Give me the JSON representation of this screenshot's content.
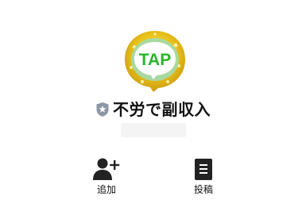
{
  "profile": {
    "logo_text": "TAP",
    "account_name": "不労で副収入",
    "badge_icon": "shield-star-icon"
  },
  "actions": [
    {
      "label": "追加",
      "icon": "add-friend-icon"
    },
    {
      "label": "投稿",
      "icon": "post-icon"
    }
  ],
  "colors": {
    "logo_text_green": "#2ab52a",
    "logo_ring_green": "#a8d9a0",
    "logo_gold": "#e8c11a",
    "badge_gray": "#8e96a6",
    "icon_dark": "#222222"
  }
}
